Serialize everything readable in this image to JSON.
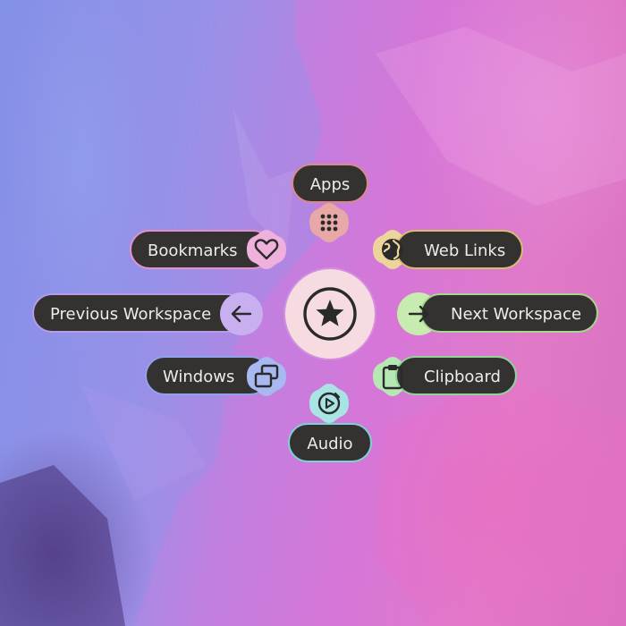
{
  "menu": {
    "center_icon": "star-icon",
    "items": [
      {
        "id": "apps",
        "label": "Apps",
        "icon": "grid-icon",
        "color": "#e8a8a8",
        "border": "#d98a8a"
      },
      {
        "id": "bookmarks",
        "label": "Bookmarks",
        "icon": "heart-icon",
        "color": "#f0b0dc",
        "border": "#e38fd0"
      },
      {
        "id": "web-links",
        "label": "Web Links",
        "icon": "globe-icon",
        "color": "#ecd59a",
        "border": "#d8be6c"
      },
      {
        "id": "previous-workspace",
        "label": "Previous Workspace",
        "icon": "arrow-left-icon",
        "color": "#c8b0f0",
        "border": "#b69be8"
      },
      {
        "id": "next-workspace",
        "label": "Next Workspace",
        "icon": "arrow-right-icon",
        "color": "#c8ecb0",
        "border": "#a4d88c"
      },
      {
        "id": "windows",
        "label": "Windows",
        "icon": "windows-icon",
        "color": "#a8b8f0",
        "border": "#8ea3ea"
      },
      {
        "id": "clipboard",
        "label": "Clipboard",
        "icon": "clipboard-icon",
        "color": "#b6e8b6",
        "border": "#8fd49a"
      },
      {
        "id": "audio",
        "label": "Audio",
        "icon": "play-circle-icon",
        "color": "#a8e4e4",
        "border": "#7cd2d2"
      }
    ]
  }
}
